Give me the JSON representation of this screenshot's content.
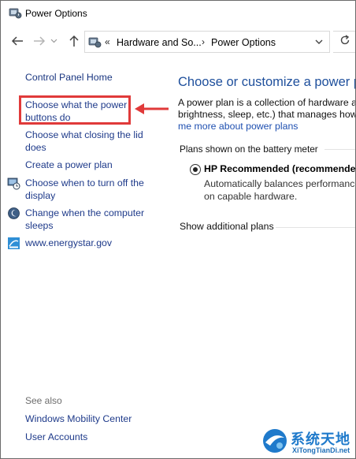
{
  "window": {
    "title": "Power Options"
  },
  "address": {
    "crumbs": [
      "Hardware and So...",
      "Power Options"
    ],
    "chevron": "«",
    "separator": "›"
  },
  "icons": {
    "app": "power-options-icon",
    "back": "back-arrow-icon",
    "forward": "forward-arrow-icon",
    "recent": "chevron-down-icon",
    "up": "up-arrow-icon",
    "refresh": "refresh-icon"
  },
  "left_pane": {
    "home": "Control Panel Home",
    "tasks": [
      {
        "label_line1": "Choose what the power",
        "label_line2": "buttons do",
        "icon": ""
      },
      {
        "label_line1": "Choose what closing the lid",
        "label_line2": "does",
        "icon": ""
      },
      {
        "label_line1": "Create a power plan",
        "label_line2": "",
        "icon": ""
      },
      {
        "label_line1": "Choose when to turn off the",
        "label_line2": "display",
        "icon": "display-clock-icon"
      },
      {
        "label_line1": "Change when the computer",
        "label_line2": "sleeps",
        "icon": "sleep-moon-icon"
      },
      {
        "label_line1": "www.energystar.gov",
        "label_line2": "",
        "icon": "energystar-icon"
      }
    ],
    "see_also_label": "See also",
    "see_also": [
      "Windows Mobility Center",
      "User Accounts"
    ]
  },
  "main": {
    "heading": "Choose or customize a power pla",
    "description_line1": "A power plan is a collection of hardware an",
    "description_line2": "brightness, sleep, etc.) that manages how y",
    "learn_more_link": "me more about power plans",
    "plans_section": "Plans shown on the battery meter",
    "plans": [
      {
        "name": "HP Recommended (recommended)",
        "selected": true,
        "description_line1": "Automatically balances performance",
        "description_line2": "on capable hardware."
      }
    ],
    "show_additional": "Show additional plans"
  },
  "annotation": {
    "highlight_color": "#e03a3a",
    "target": "Choose what the power buttons do"
  },
  "watermark": {
    "text": "系统天地",
    "sub": "XiTongTianDi.net",
    "color": "#1f7acb"
  },
  "colors": {
    "link": "#1e3a8a",
    "heading": "#1e4f9c",
    "accent_red": "#e03a3a"
  }
}
